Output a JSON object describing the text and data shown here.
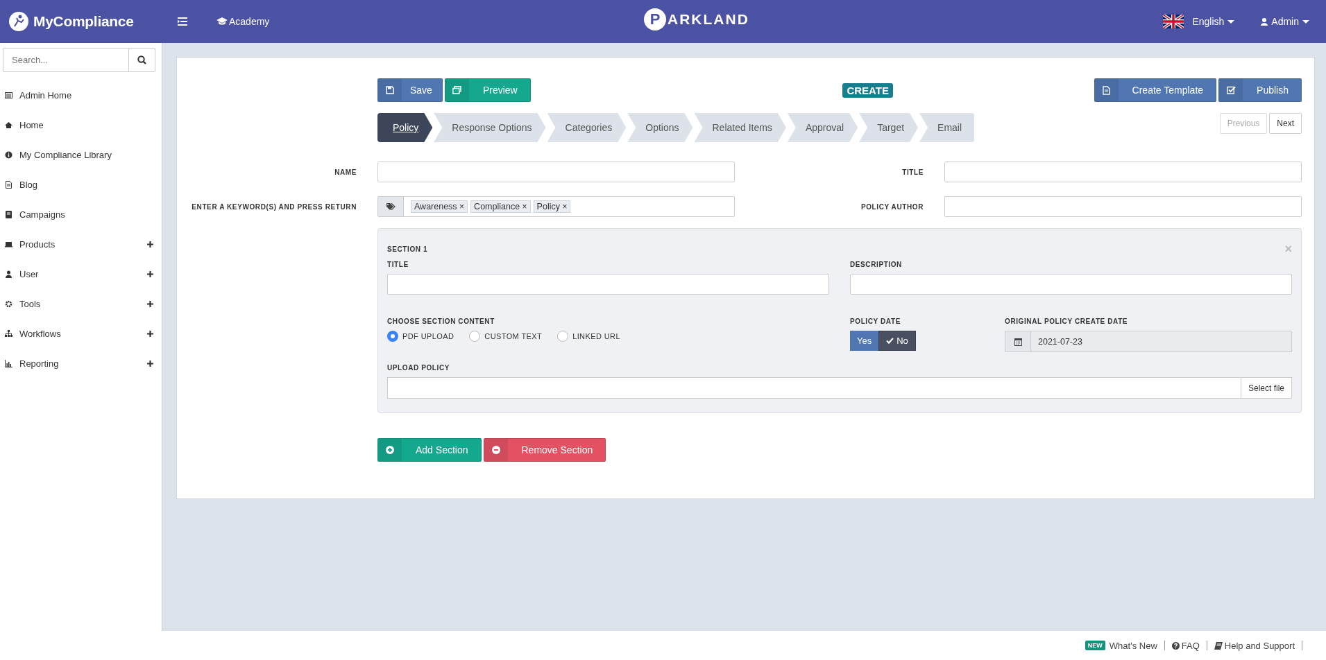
{
  "header": {
    "brand": "MyCompliance",
    "nav_link": "Academy",
    "logo_initial": "P",
    "logo_rest": "ARKLAND",
    "language": "English",
    "user": "Admin"
  },
  "sidebar": {
    "search": {
      "placeholder": "Search..."
    },
    "items": [
      {
        "label": "Admin Home",
        "expandable": false
      },
      {
        "label": "Home",
        "expandable": false
      },
      {
        "label": "My Compliance Library",
        "expandable": false
      },
      {
        "label": "Blog",
        "expandable": false
      },
      {
        "label": "Campaigns",
        "expandable": false
      },
      {
        "label": "Products",
        "expandable": true
      },
      {
        "label": "User",
        "expandable": true
      },
      {
        "label": "Tools",
        "expandable": true
      },
      {
        "label": "Workflows",
        "expandable": true
      },
      {
        "label": "Reporting",
        "expandable": true
      }
    ]
  },
  "toolbar": {
    "save": "Save",
    "preview": "Preview",
    "mode_badge": "CREATE",
    "create_template": "Create Template",
    "publish": "Publish"
  },
  "steps": [
    {
      "label": "Policy",
      "selected": true
    },
    {
      "label": "Response Options",
      "selected": false
    },
    {
      "label": "Categories",
      "selected": false
    },
    {
      "label": "Options",
      "selected": false
    },
    {
      "label": "Related Items",
      "selected": false
    },
    {
      "label": "Approval",
      "selected": false
    },
    {
      "label": "Target",
      "selected": false
    },
    {
      "label": "Email",
      "selected": false
    }
  ],
  "pager": [
    {
      "label": "Previous",
      "disabled": true
    },
    {
      "label": "Next",
      "disabled": false
    }
  ],
  "form": {
    "name_label": "NAME",
    "title_label": "TITLE",
    "keywords_label": "ENTER A KEYWORD(S) AND PRESS RETURN",
    "author_label": "POLICY AUTHOR",
    "tags": [
      "Awareness",
      "Compliance",
      "Policy"
    ],
    "tag_remove": "×"
  },
  "section": {
    "heading": "SECTION 1",
    "close": "×",
    "title_label": "TITLE",
    "description_label": "DESCRIPTION",
    "content_label": "CHOOSE SECTION CONTENT",
    "content_options": [
      {
        "label": "PDF UPLOAD",
        "selected": true
      },
      {
        "label": "CUSTOM TEXT",
        "selected": false
      },
      {
        "label": "LINKED URL",
        "selected": false
      }
    ],
    "policy_date_label": "POLICY DATE",
    "policy_date_options": [
      {
        "label": "Yes",
        "selected": false
      },
      {
        "label": "No",
        "selected": true
      }
    ],
    "create_date_label": "ORIGINAL POLICY CREATE DATE",
    "create_date": "2021-07-23",
    "upload_label": "UPLOAD POLICY",
    "select_file": "Select file"
  },
  "actions": {
    "add": "Add Section",
    "remove": "Remove Section"
  },
  "footer": {
    "new_badge": "NEW",
    "whats_new": "What's New",
    "faq": "FAQ",
    "help": "Help and Support"
  }
}
